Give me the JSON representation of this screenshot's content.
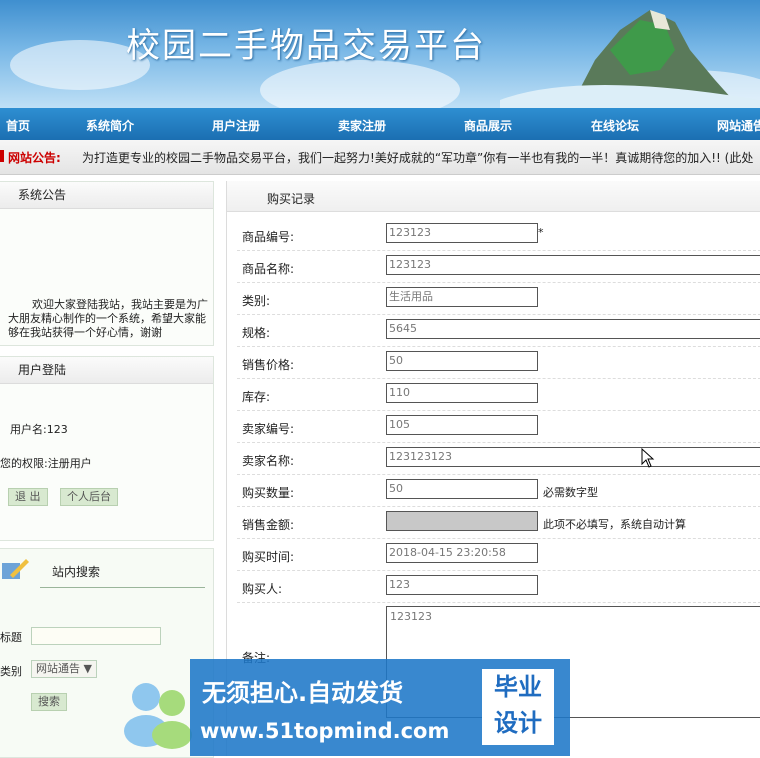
{
  "header": {
    "title": "校园二手物品交易平台"
  },
  "nav": [
    "首页",
    "系统简介",
    "用户注册",
    "卖家注册",
    "商品展示",
    "在线论坛",
    "网站通告"
  ],
  "notice": {
    "label": "网站公告:",
    "text": "为打造更专业的校园二手物品交易平台，我们一起努力!美好成就的“军功章”你有一半也有我的一半！真诚期待您的加入!! (此处"
  },
  "sidebar": {
    "announcement": {
      "title": "系统公告",
      "text": "欢迎大家登陆我站，我站主要是为广大朋友精心制作的一个系统，希望大家能够在我站获得一个好心情，谢谢"
    },
    "login": {
      "title": "用户登陆",
      "username": "用户名:123",
      "permission": "您的权限:注册用户",
      "logout": "退 出",
      "backend": "个人后台"
    },
    "search": {
      "title": "站内搜索",
      "title_label": "标题",
      "category_label": "类别",
      "category_value": "网站通告",
      "button": "搜索"
    }
  },
  "main": {
    "title": "购买记录",
    "fields": [
      {
        "label": "商品编号:",
        "value": "123123",
        "suffix": "*"
      },
      {
        "label": "商品名称:",
        "value": "123123"
      },
      {
        "label": "类别:",
        "value": "生活用品"
      },
      {
        "label": "规格:",
        "value": "5645"
      },
      {
        "label": "销售价格:",
        "value": "50"
      },
      {
        "label": "库存:",
        "value": "110"
      },
      {
        "label": "卖家编号:",
        "value": "105"
      },
      {
        "label": "卖家名称:",
        "value": "123123123"
      },
      {
        "label": "购买数量:",
        "value": "50",
        "hint": "必需数字型"
      },
      {
        "label": "销售金额:",
        "value": "",
        "hint": "此项不必填写，系统自动计算"
      },
      {
        "label": "购买时间:",
        "value": "2018-04-15 23:20:58"
      },
      {
        "label": "购买人:",
        "value": "123"
      }
    ],
    "remark": {
      "label": "备注:",
      "value": "123123"
    }
  },
  "watermark": {
    "line1": "无须担心.自动发货",
    "line2": "www.51topmind.com",
    "badge1": "毕业",
    "badge2": "设计"
  }
}
